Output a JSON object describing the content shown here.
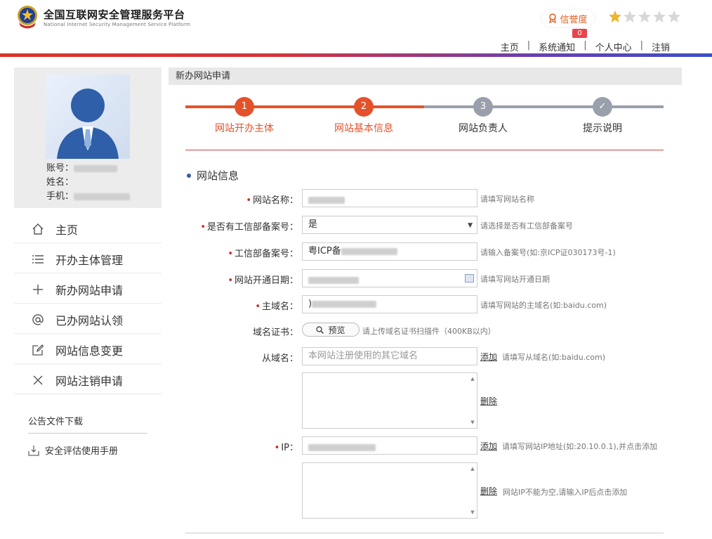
{
  "header": {
    "site_title": "全国互联网安全管理服务平台",
    "site_subtitle": "National Internet Security Management Service Platform",
    "credit_label": "信誉度",
    "stars_total": 5,
    "stars_filled": 1,
    "notification_count": "0",
    "nav": [
      "主页",
      "系统通知",
      "个人中心",
      "注销"
    ],
    "nav_separator": "|",
    "accent_color": "#d9352a"
  },
  "sidebar": {
    "profile": {
      "account_label": "账号：",
      "name_label": "姓名：",
      "phone_label": "手机："
    },
    "menu": [
      {
        "label": "主页",
        "icon": "home-icon"
      },
      {
        "label": "开办主体管理",
        "icon": "list-icon"
      },
      {
        "label": "新办网站申请",
        "icon": "plus-icon"
      },
      {
        "label": "已办网站认领",
        "icon": "at-icon"
      },
      {
        "label": "网站信息变更",
        "icon": "edit-icon"
      },
      {
        "label": "网站注销申请",
        "icon": "close-icon"
      }
    ],
    "downloads_title": "公告文件下载",
    "downloads": [
      {
        "label": "安全评估使用手册",
        "icon": "download-icon"
      }
    ]
  },
  "main": {
    "title": "新办网站申请",
    "steps": [
      {
        "num": "1",
        "label": "网站开办主体",
        "state": "done"
      },
      {
        "num": "2",
        "label": "网站基本信息",
        "state": "active"
      },
      {
        "num": "3",
        "label": "网站负责人",
        "state": "pending"
      },
      {
        "num": "✓",
        "label": "提示说明",
        "state": "pending"
      }
    ],
    "colors": {
      "active": "#e4522a",
      "pending": "#9aa0ab"
    },
    "section_title": "网站信息",
    "form": {
      "site_name": {
        "label": "网站名称：",
        "hint": "请填写网站名称"
      },
      "has_icp": {
        "label": "是否有工信部备案号：",
        "value": "是",
        "hint": "请选择是否有工信部备案号"
      },
      "icp_number": {
        "label": "工信部备案号：",
        "value": "粤ICP备",
        "hint": "请输入备案号(如:京ICP证030173号-1)"
      },
      "open_date": {
        "label": "网站开通日期：",
        "hint": "请填写网站开通日期"
      },
      "main_domain": {
        "label": "主域名：",
        "value": ")",
        "hint": "请填写网站的主域名(如:baidu.com)"
      },
      "domain_cert": {
        "label": "域名证书：",
        "button": "预览",
        "hint": "请上传域名证书扫描件（400KB以内）"
      },
      "sub_domain": {
        "label": "从域名：",
        "placeholder": "本网站注册使用的其它域名",
        "add": "添加",
        "hint": "请填写从域名(如:baidu.com)",
        "delete": "删除"
      },
      "ip": {
        "label": "IP：",
        "add": "添加",
        "hint": "请填写网站IP地址(如:20.10.0.1),并点击添加",
        "delete": "删除",
        "delete_hint": "网站IP不能为空,请输入IP后点击添加"
      }
    }
  }
}
